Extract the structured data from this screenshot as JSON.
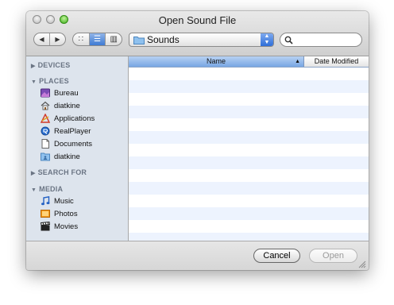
{
  "window": {
    "title": "Open Sound File"
  },
  "toolbar": {
    "back_glyph": "◀",
    "forward_glyph": "▶",
    "view_icons": "∷",
    "view_list": "☰",
    "view_columns": "▥",
    "location": "Sounds",
    "stepper_up": "▲",
    "stepper_down": "▼",
    "search_placeholder": ""
  },
  "sidebar": {
    "devices": "DEVICES",
    "places": "PLACES",
    "places_items": [
      "Bureau",
      "diatkine",
      "Applications",
      "RealPlayer",
      "Documents",
      "diatkine"
    ],
    "search_for": "SEARCH FOR",
    "media": "MEDIA",
    "media_items": [
      "Music",
      "Photos",
      "Movies"
    ],
    "collapsed_glyph": "▶",
    "expanded_glyph": "▼"
  },
  "filelist": {
    "columns": [
      "Name",
      "Date Modified"
    ],
    "sort_glyph": "▲",
    "rows": []
  },
  "buttons": {
    "cancel": "Cancel",
    "open": "Open"
  },
  "colors": {
    "accent": "#3f7bd4",
    "sidebar_bg": "#dde4ed",
    "stripe": "#edf3fe"
  }
}
